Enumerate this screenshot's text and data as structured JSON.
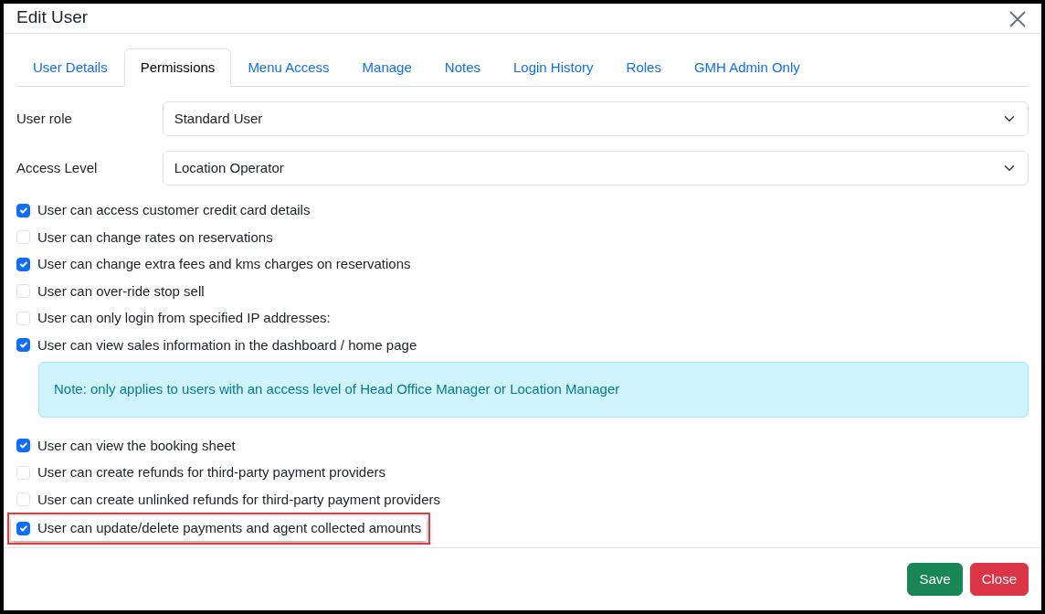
{
  "window": {
    "title": "Edit User"
  },
  "tabs": [
    {
      "label": "User Details",
      "selected": false
    },
    {
      "label": "Permissions",
      "selected": true
    },
    {
      "label": "Menu Access",
      "selected": false
    },
    {
      "label": "Manage",
      "selected": false
    },
    {
      "label": "Notes",
      "selected": false
    },
    {
      "label": "Login History",
      "selected": false
    },
    {
      "label": "Roles",
      "selected": false
    },
    {
      "label": "GMH Admin Only",
      "selected": false
    }
  ],
  "fields": [
    {
      "label": "User role",
      "value": "Standard User"
    },
    {
      "label": "Access Level",
      "value": "Location Operator"
    }
  ],
  "permissions": [
    {
      "kind": "checkbox",
      "label": "User can access customer credit card details",
      "checked": true,
      "highlighted": false
    },
    {
      "kind": "checkbox",
      "label": "User can change rates on reservations",
      "checked": false,
      "highlighted": false
    },
    {
      "kind": "checkbox",
      "label": "User can change extra fees and kms charges on reservations",
      "checked": true,
      "highlighted": false
    },
    {
      "kind": "checkbox",
      "label": "User can over-ride stop sell",
      "checked": false,
      "highlighted": false
    },
    {
      "kind": "checkbox",
      "label": "User can only login from specified IP addresses:",
      "checked": false,
      "highlighted": false
    },
    {
      "kind": "checkbox",
      "label": "User can view sales information in the dashboard / home page",
      "checked": true,
      "highlighted": false
    },
    {
      "kind": "note",
      "label": "Note: only applies to users with an access level of Head Office Manager or Location Manager"
    },
    {
      "kind": "checkbox",
      "label": "User can view the booking sheet",
      "checked": true,
      "highlighted": false
    },
    {
      "kind": "checkbox",
      "label": "User can create refunds for third-party payment providers",
      "checked": false,
      "highlighted": false
    },
    {
      "kind": "checkbox",
      "label": "User can create unlinked refunds for third-party payment providers",
      "checked": false,
      "highlighted": false
    },
    {
      "kind": "checkbox",
      "label": "User can update/delete payments and agent collected amounts",
      "checked": true,
      "highlighted": true
    }
  ],
  "buttons": [
    {
      "kind": "save",
      "label": "Save"
    },
    {
      "kind": "close",
      "label": "Close"
    }
  ]
}
